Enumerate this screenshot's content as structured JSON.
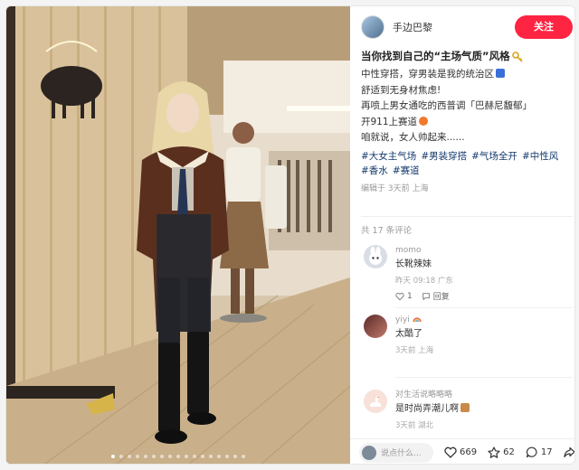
{
  "colors": {
    "accent": "#ff2442",
    "tag": "#13386c",
    "muted": "#999999"
  },
  "author": {
    "name": "手边巴黎",
    "avatar_icon": "user-avatar",
    "follow_label": "关注"
  },
  "post": {
    "title": "当你找到自己的“主场气质”风格",
    "title_emoji_icon": "key-icon",
    "lines": [
      "中性穿搭，穿男装是我的统治区",
      "舒适到无身材焦虑!",
      "再喷上男女通吃的西普调「巴赫尼馥郁」",
      "开911上赛道",
      "咱就说，女人帅起来......"
    ],
    "tags": [
      "#大女主气场",
      "#男装穿搭",
      "#气场全开",
      "#中性风",
      "#香水",
      "#赛道"
    ],
    "meta": "编辑于 3天前 上海"
  },
  "comments_section": {
    "count_label": "共 17 条评论",
    "comments": [
      {
        "name": "momo",
        "text": "长靴辣妹",
        "meta": "昨天 09:18 广东",
        "likes": "1",
        "reply_label": "回复"
      },
      {
        "name": "yiyi",
        "text": "太酷了",
        "meta": "3天前 上海",
        "likes": "",
        "reply_label": ""
      },
      {
        "name": "对生活说略略略",
        "text": "是时尚弄潮儿啊",
        "meta": "3天前 湖北",
        "likes": "",
        "reply_label": ""
      }
    ]
  },
  "bottom_bar": {
    "comment_placeholder": "说点什么...",
    "likes": "669",
    "stars": "62",
    "comments": "17"
  },
  "carousel": {
    "total": 17,
    "active_index": 0
  }
}
